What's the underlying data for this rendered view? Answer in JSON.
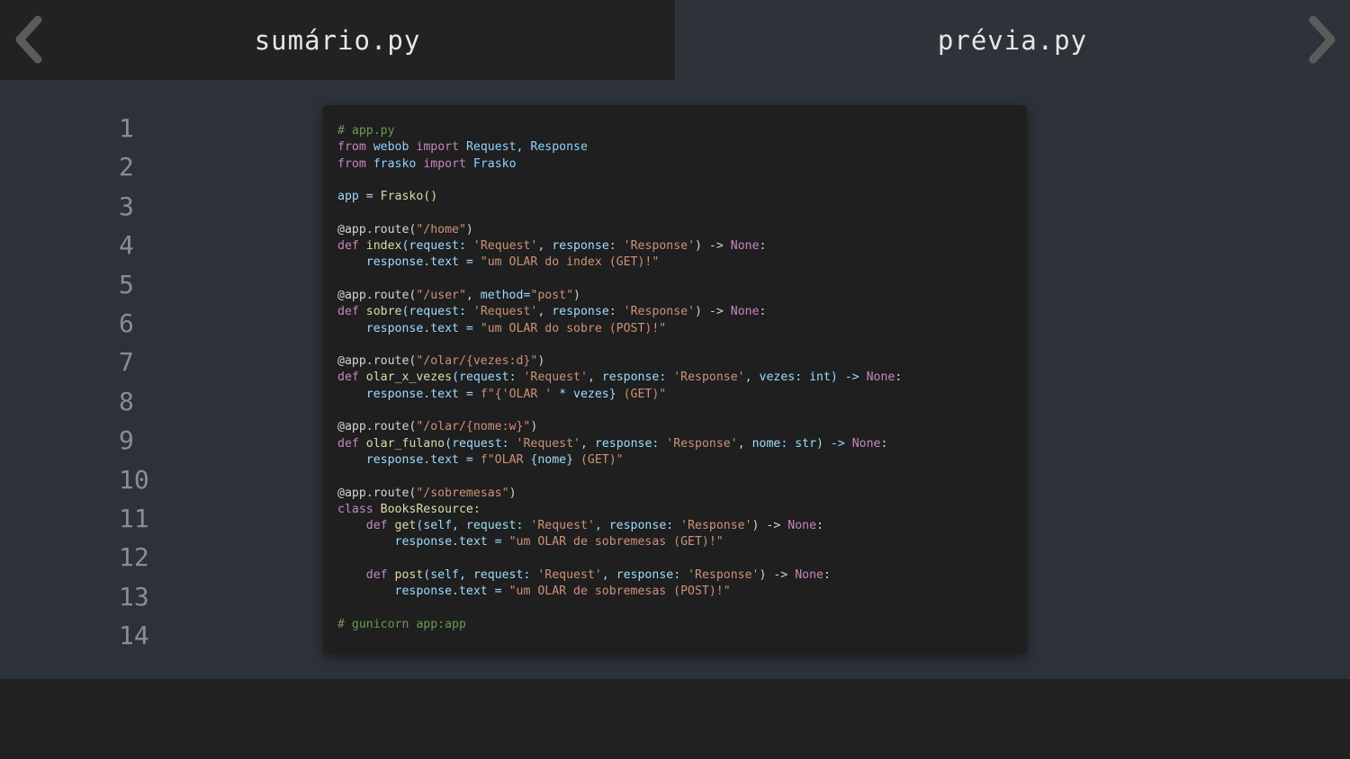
{
  "tabs": {
    "left_label": "sumário.py",
    "right_label": "prévia.py"
  },
  "nav": {
    "prev_icon": "chevron-left-icon",
    "next_icon": "chevron-right-icon"
  },
  "line_numbers": [
    "1",
    "2",
    "3",
    "4",
    "5",
    "6",
    "7",
    "8",
    "9",
    "10",
    "11",
    "12",
    "13",
    "14"
  ],
  "code": {
    "l1": "# app.py",
    "l2_from": "from",
    "l2_mod": "webob",
    "l2_import": "import",
    "l2_names": "Request, Response",
    "l3_from": "from",
    "l3_mod": "frasko",
    "l3_import": "import",
    "l3_names": "Frasko",
    "l5_app": "app",
    "l5_eq": " = ",
    "l5_call": "Frasko()",
    "l7_dec": "@app.route(",
    "l7_str": "\"/home\"",
    "l7_end": ")",
    "l8_def": "def",
    "l8_fn": "index",
    "l8_a": "(request: ",
    "l8_s1": "'Request'",
    "l8_b": ", response: ",
    "l8_s2": "'Response'",
    "l8_c": ") -> ",
    "l8_none": "None",
    "l8_d": ":",
    "l9_lhs": "    response.text = ",
    "l9_str": "\"um OLAR do index (GET)!\"",
    "l11_dec": "@app.route(",
    "l11_str": "\"/user\"",
    "l11_mid": ", method=",
    "l11_str2": "\"post\"",
    "l11_end": ")",
    "l12_def": "def",
    "l12_fn": "sobre",
    "l12_a": "(request: ",
    "l12_s1": "'Request'",
    "l12_b": ", response: ",
    "l12_s2": "'Response'",
    "l12_c": ") -> ",
    "l12_none": "None",
    "l12_d": ":",
    "l13_lhs": "    response.text = ",
    "l13_str": "\"um OLAR do sobre (POST)!\"",
    "l15_dec": "@app.route(",
    "l15_str": "\"/olar/{vezes:d}\"",
    "l15_end": ")",
    "l16_def": "def",
    "l16_fn": "olar_x_vezes",
    "l16_a": "(request: ",
    "l16_s1": "'Request'",
    "l16_b": ", response: ",
    "l16_s2": "'Response'",
    "l16_c": ", vezes: int) -> ",
    "l16_none": "None",
    "l16_d": ":",
    "l17_lhs": "    response.text = ",
    "l17_f": "f\"{",
    "l17_s": "'OLAR '",
    "l17_mid": " * vezes}",
    "l17_end": " (GET)\"",
    "l19_dec": "@app.route(",
    "l19_str": "\"/olar/{nome:w}\"",
    "l19_end": ")",
    "l20_def": "def",
    "l20_fn": "olar_fulano",
    "l20_a": "(request: ",
    "l20_s1": "'Request'",
    "l20_b": ", response: ",
    "l20_s2": "'Response'",
    "l20_c": ", nome: str) -> ",
    "l20_none": "None",
    "l20_d": ":",
    "l21_lhs": "    response.text = ",
    "l21_f": "f\"OLAR ",
    "l21_v": "{nome}",
    "l21_end": " (GET)\"",
    "l23_dec": "@app.route(",
    "l23_str": "\"/sobremesas\"",
    "l23_end": ")",
    "l24_cls": "class",
    "l24_name": " BooksResource:",
    "l25_def": "    def",
    "l25_fn": " get",
    "l25_a": "(self, request: ",
    "l25_s1": "'Request'",
    "l25_b": ", response: ",
    "l25_s2": "'Response'",
    "l25_c": ") -> ",
    "l25_none": "None",
    "l25_d": ":",
    "l26_lhs": "        response.text = ",
    "l26_str": "\"um OLAR de sobremesas (GET)!\"",
    "l28_def": "    def",
    "l28_fn": " post",
    "l28_a": "(self, request: ",
    "l28_s1": "'Request'",
    "l28_b": ", response: ",
    "l28_s2": "'Response'",
    "l28_c": ") -> ",
    "l28_none": "None",
    "l28_d": ":",
    "l29_lhs": "        response.text = ",
    "l29_str": "\"um OLAR de sobremesas (POST)!\"",
    "l31": "# gunicorn app:app"
  }
}
